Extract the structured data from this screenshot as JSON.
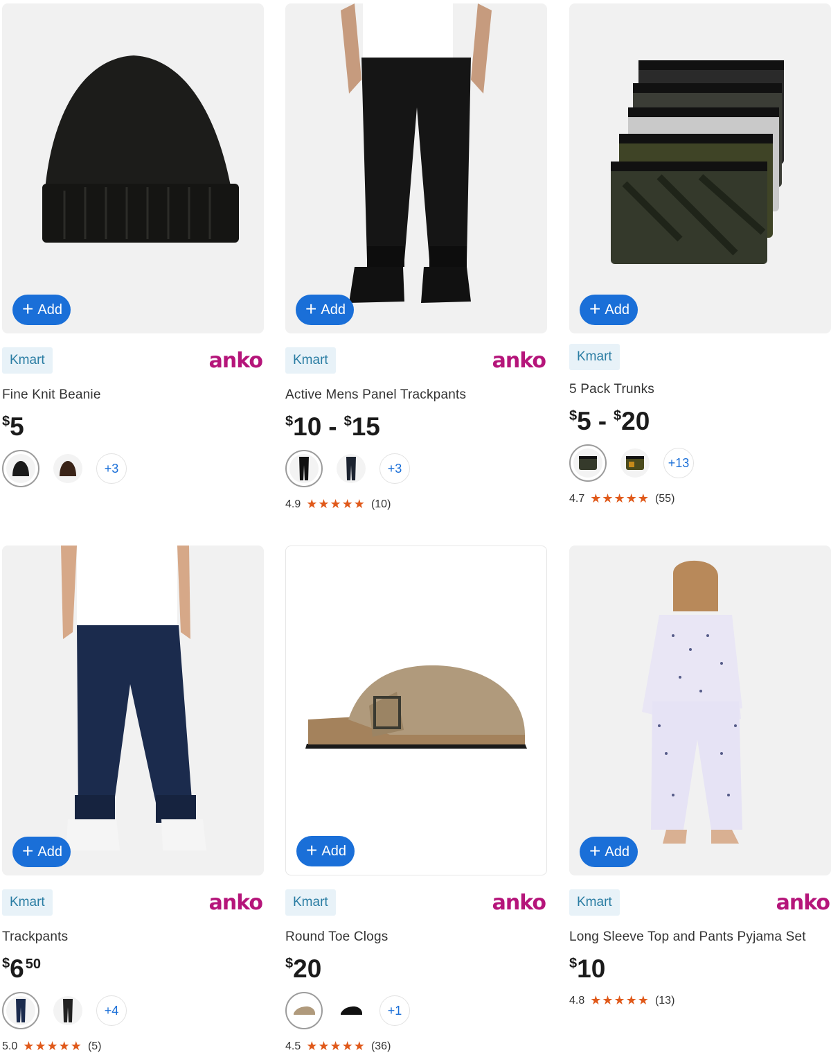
{
  "add_label": "Add",
  "kmart_label": "Kmart",
  "anko_label": "anko",
  "products": [
    {
      "title": "Fine Knit Beanie",
      "price": {
        "d1": "5"
      },
      "swatch_more": "+3"
    },
    {
      "title": "Active Mens Panel Trackpants",
      "price": {
        "d1": "10",
        "d2": "15"
      },
      "swatch_more": "+3",
      "rating": {
        "score": "4.9",
        "count": "(10)",
        "stars": "★★★★★"
      }
    },
    {
      "title": "5 Pack Trunks",
      "price": {
        "d1": "5",
        "d2": "20"
      },
      "swatch_more": "+13",
      "rating": {
        "score": "4.7",
        "count": "(55)",
        "stars": "★★★★★"
      }
    },
    {
      "title": "Trackpants",
      "price": {
        "d1": "6",
        "cents": "50"
      },
      "swatch_more": "+4",
      "rating": {
        "score": "5.0",
        "count": "(5)",
        "stars": "★★★★★"
      }
    },
    {
      "title": "Round Toe Clogs",
      "price": {
        "d1": "20"
      },
      "swatch_more": "+1",
      "rating": {
        "score": "4.5",
        "count": "(36)",
        "stars": "★★★★★"
      }
    },
    {
      "title": "Long Sleeve Top and Pants Pyjama Set",
      "price": {
        "d1": "10"
      },
      "rating": {
        "score": "4.8",
        "count": "(13)",
        "stars": "★★★★★"
      }
    }
  ],
  "currency": "$",
  "dash": "-",
  "colors": {
    "accent": "#1a6fd8",
    "anko": "#b5157a",
    "star": "#e0591a",
    "kmart_bg": "#e8f2f8"
  }
}
